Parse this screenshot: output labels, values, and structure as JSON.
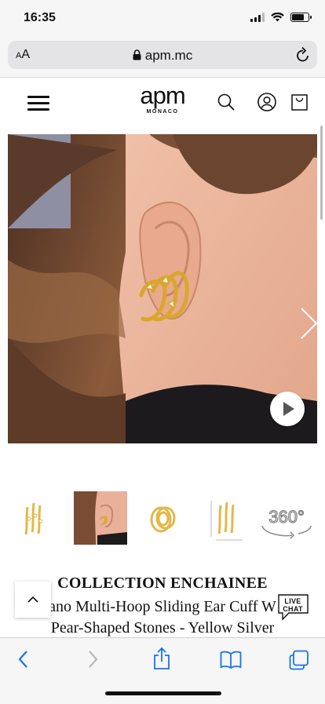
{
  "status_bar": {
    "time": "16:35",
    "battery_level": 0.7
  },
  "browser": {
    "text_size_small": "A",
    "text_size_large": "A",
    "url": "apm.mc",
    "icons": [
      "lock-icon",
      "reload-icon"
    ]
  },
  "site": {
    "logo_main": "apm",
    "logo_sub": "MONACO",
    "header_icons": [
      "menu-icon",
      "search-icon",
      "account-icon",
      "shopping-bag-icon"
    ]
  },
  "gallery": {
    "thumbnails": [
      "earring-front-view",
      "earring-on-ear",
      "earring-side-view",
      "earring-with-dimensions",
      "360-view"
    ],
    "view_360_label": "360°",
    "icons": [
      "chevron-right-icon",
      "play-icon"
    ]
  },
  "product": {
    "collection": "COLLECTION ENCHAINEE",
    "name_line1": "ano Multi-Hoop Sliding Ear Cuff W",
    "name_line2": "Pear-Shaped Stones - Yellow Silver"
  },
  "live_chat": {
    "line1": "LIVE",
    "line2": "CHAT"
  },
  "toolbar": {
    "icons": [
      "back-icon",
      "forward-icon",
      "share-icon",
      "bookmarks-icon",
      "tabs-icon"
    ]
  },
  "colors": {
    "accent": "#1a73e8",
    "gold": "#d9a72c"
  }
}
